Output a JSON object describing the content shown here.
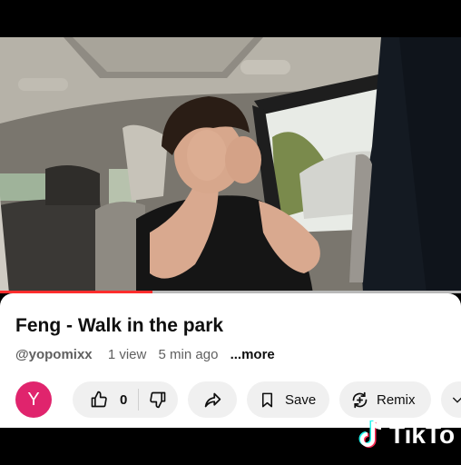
{
  "video": {
    "description": "",
    "progress": 0.33
  },
  "details": {
    "title": "Feng - Walk in the park",
    "channel": "@yopomixx",
    "views": "1 view",
    "time": "5 min ago",
    "more": "...more"
  },
  "actions": {
    "avatar_letter": "Y",
    "like_count": "0",
    "save_label": "Save",
    "remix_label": "Remix"
  },
  "watermark": {
    "text": "TikTo"
  },
  "colors": {
    "avatar": "#e0246d",
    "progress": "#ff2d2d",
    "pill": "#f0f0f0"
  }
}
